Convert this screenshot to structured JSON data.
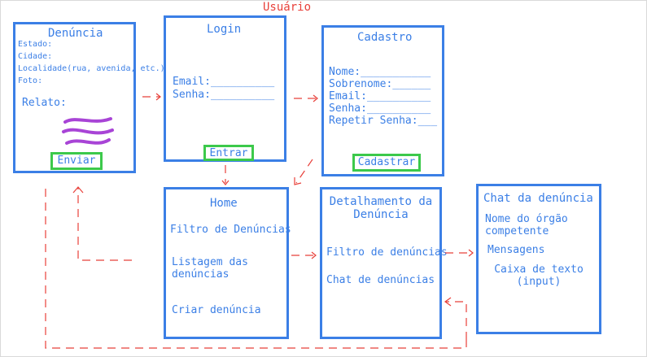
{
  "page_title": "Usuário",
  "colors": {
    "box": "#3b7fe6",
    "button": "#3cc94b",
    "arrow": "#e8403a",
    "scribble": "#a844d6"
  },
  "denuncia": {
    "title": "Denúncia",
    "fields": [
      "Estado:",
      "Cidade:",
      "Localidade(rua, avenida, etc.):",
      "Foto:"
    ],
    "relato": "Relato:",
    "button": "Enviar"
  },
  "login": {
    "title": "Login",
    "fields": [
      "Email:__________",
      "Senha:__________"
    ],
    "button": "Entrar"
  },
  "cadastro": {
    "title": "Cadastro",
    "fields": [
      "Nome:___________",
      "Sobrenome:______",
      "Email:__________",
      "Senha:__________",
      "Repetir Senha:___"
    ],
    "button": "Cadastrar"
  },
  "home": {
    "title": "Home",
    "items": [
      "Filtro de Denúncias",
      "Listagem das\ndenúncias",
      "Criar denúncia"
    ]
  },
  "detalhamento": {
    "title": "Detalhamento da\nDenúncia",
    "items": [
      "Filtro de denúncias",
      "Chat de denúncias"
    ]
  },
  "chat": {
    "title": "Chat da denúncia",
    "items": [
      "Nome do órgão\ncompetente",
      "Mensagens",
      "Caixa de texto\n(input)"
    ]
  }
}
